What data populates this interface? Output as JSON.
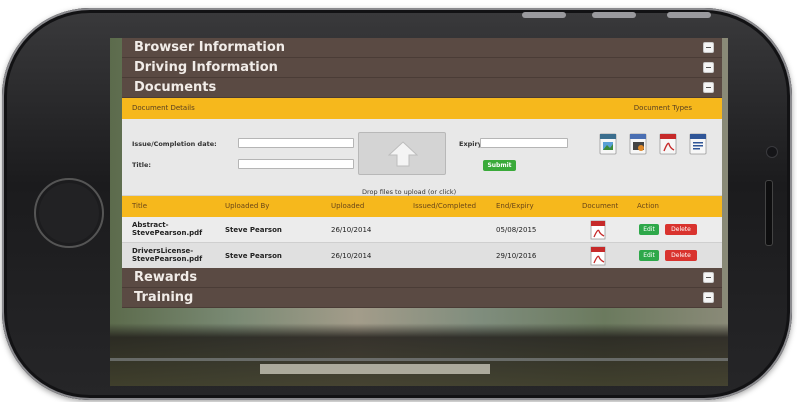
{
  "sections_top": [
    {
      "label": "Browser Information"
    },
    {
      "label": "Driving Information"
    },
    {
      "label": "Documents"
    }
  ],
  "doc_header": {
    "left": "Document Details",
    "right": "Document Types"
  },
  "upload": {
    "issue_label": "Issue/Completion date:",
    "title_label": "Title:",
    "expiry_label": "Expiry:",
    "submit_label": "Submit",
    "drop_hint": "Drop files to upload (or click)"
  },
  "doc_types": [
    "image-file-icon",
    "video-file-icon",
    "pdf-file-icon",
    "word-file-icon"
  ],
  "table": {
    "headers": [
      "Title",
      "Uploaded By",
      "Uploaded",
      "Issued/Completed",
      "End/Expiry",
      "Document",
      "Action"
    ],
    "rows": [
      {
        "title_line1": "Abstract-",
        "title_line2": "StevePearson.pdf",
        "uploaded_by": "Steve Pearson",
        "uploaded": "26/10/2014",
        "issued": "",
        "expiry": "05/08/2015"
      },
      {
        "title_line1": "DriversLicense-",
        "title_line2": "StevePearson.pdf",
        "uploaded_by": "Steve Pearson",
        "uploaded": "26/10/2014",
        "issued": "",
        "expiry": "29/10/2016"
      }
    ],
    "edit_label": "Edit",
    "delete_label": "Delete"
  },
  "sections_bottom": [
    {
      "label": "Rewards"
    },
    {
      "label": "Training"
    }
  ],
  "colors": {
    "section_bar": "#5a4a43",
    "accent_yellow": "#f6b81c",
    "edit_green": "#2ea84a",
    "delete_red": "#d9332e"
  }
}
